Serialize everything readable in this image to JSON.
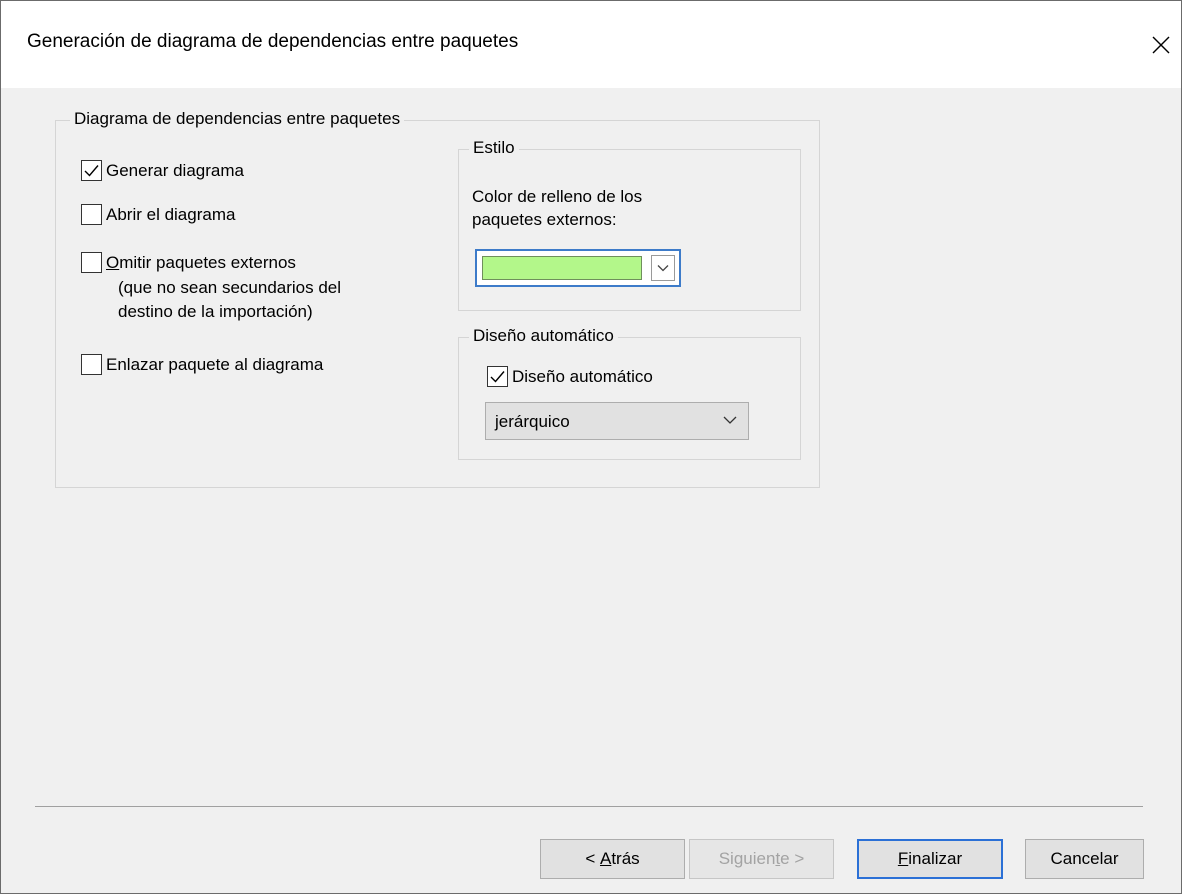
{
  "dialog": {
    "title": "Generación de diagrama de dependencias entre paquetes"
  },
  "main_group": {
    "legend": "Diagrama de dependencias entre paquetes",
    "checkboxes": [
      {
        "label_first": "",
        "label_accel": "",
        "label_rest": "Generar diagrama",
        "checked": true
      },
      {
        "label_first": "",
        "label_accel": "",
        "label_rest": "Abrir el diagrama",
        "checked": false
      },
      {
        "label_first": "",
        "label_accel": "O",
        "label_rest": "mitir paquetes externos",
        "checked": false
      },
      {
        "label_first": "",
        "label_accel": "",
        "label_rest": "Enlazar paquete al diagrama",
        "checked": false
      }
    ],
    "omit_note_line1": "(que no sean secundarios del",
    "omit_note_line2": "destino de la importación)"
  },
  "style_group": {
    "legend": "Estilo",
    "fill_label_line1": "Color de relleno de los",
    "fill_label_line2": "paquetes externos:",
    "fill_color": "#b3f78a"
  },
  "layout_group": {
    "legend": "Diseño automático",
    "checkbox_label": "Diseño automático",
    "checked": true,
    "selected_layout": "jerárquico"
  },
  "buttons": {
    "back_prefix": "< ",
    "back_accel": "A",
    "back_rest": "trás",
    "next_prefix": "Siguien",
    "next_accel": "t",
    "next_rest": "e >",
    "finish_accel": "F",
    "finish_rest": "inalizar",
    "cancel": "Cancelar"
  },
  "icons": {
    "close": "close-icon",
    "check": "checkmark-icon",
    "dropdown": "chevron-down-icon"
  }
}
